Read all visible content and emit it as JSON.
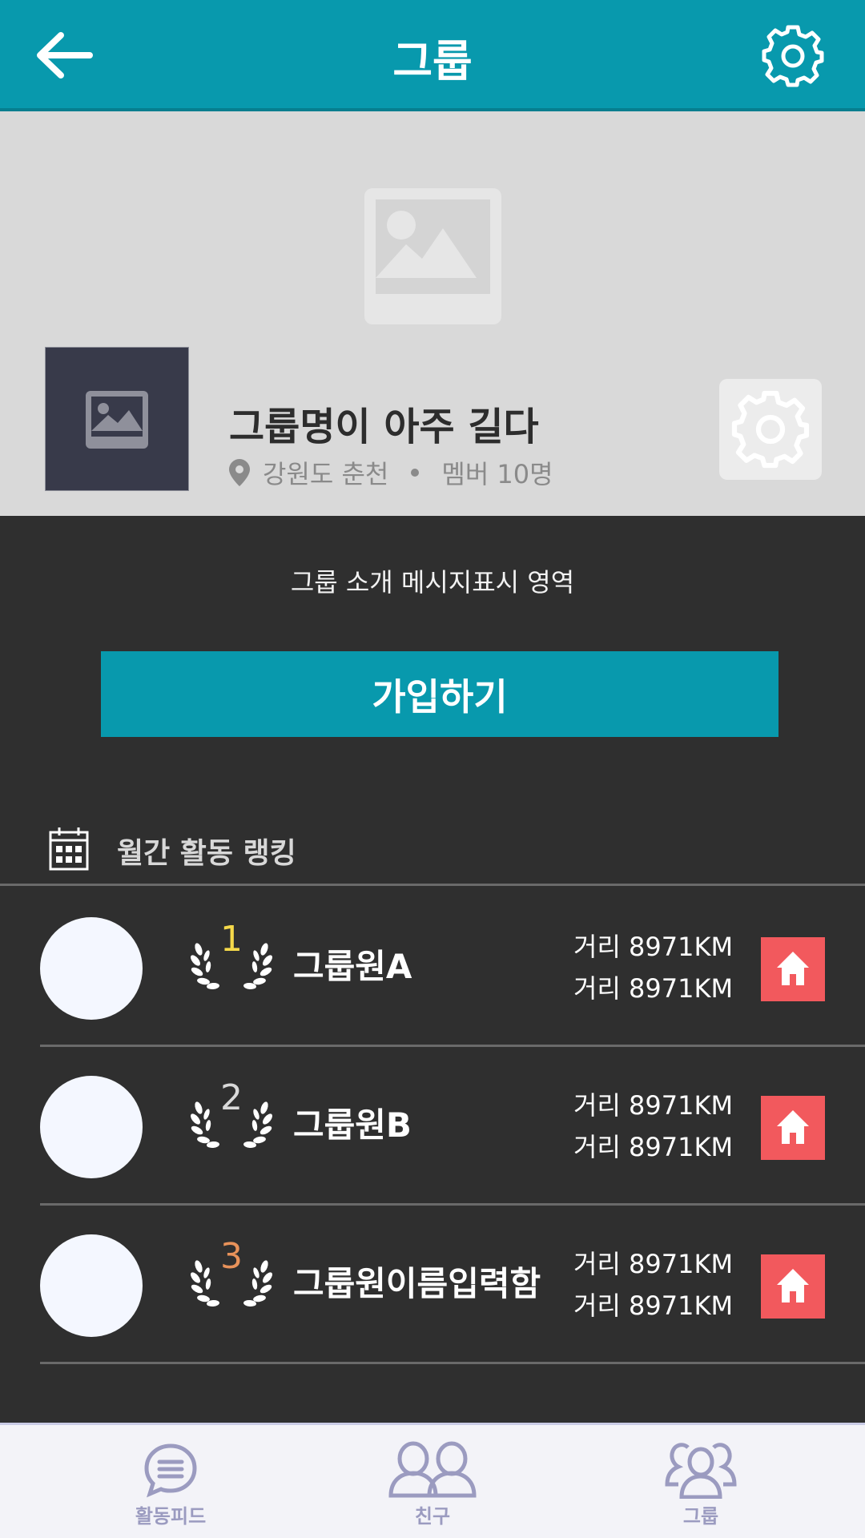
{
  "header": {
    "title": "그룹",
    "back_icon": "arrow-left-icon",
    "settings_icon": "gear-icon"
  },
  "group": {
    "name": "그룹명이 아주 길다",
    "location": "강원도 춘천",
    "members": "멤버 10명",
    "intro": "그룹 소개 메시지표시 영역",
    "join_label": "가입하기"
  },
  "ranking": {
    "title": "월간 활동 랭킹",
    "items": [
      {
        "rank": "1",
        "name": "그룹원A",
        "line1": "거리 8971KM",
        "line2": "거리 8971KM",
        "rank_color": "#f5d94a"
      },
      {
        "rank": "2",
        "name": "그룹원B",
        "line1": "거리 8971KM",
        "line2": "거리 8971KM",
        "rank_color": "#d9d9d9"
      },
      {
        "rank": "3",
        "name": "그룹원이름입력함",
        "line1": "거리 8971KM",
        "line2": "거리 8971KM",
        "rank_color": "#e8925a"
      }
    ]
  },
  "tabs": [
    {
      "label": "활동피드",
      "icon": "chat-bubble-icon"
    },
    {
      "label": "친구",
      "icon": "friends-icon"
    },
    {
      "label": "그룹",
      "icon": "group-icon"
    }
  ],
  "colors": {
    "primary": "#0899ad",
    "home_button": "#f2595d",
    "background": "#2f2f2f"
  }
}
